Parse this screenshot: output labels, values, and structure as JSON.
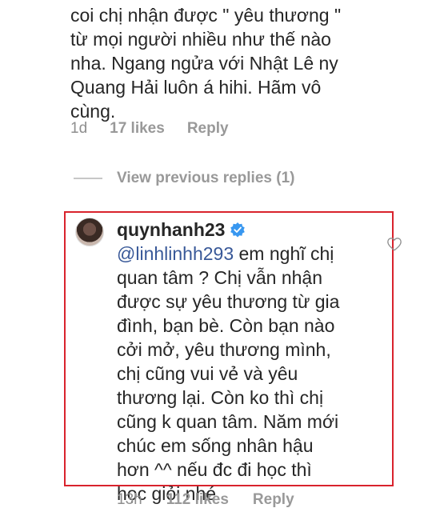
{
  "top_comment": {
    "text": "coi chị nhận được \" yêu thương \"\ntừ mọi người nhiều như thế nào\nnha. Ngang ngửa với Nhật Lê ny\nQuang Hải luôn á hihi. Hãm vô\ncùng.",
    "time": "1d",
    "likes": "17 likes",
    "reply_label": "Reply"
  },
  "view_previous": {
    "label": "View previous replies (1)"
  },
  "reply": {
    "username": "quynhanh23",
    "mention": "@linhlinhh293",
    "text": " em nghĩ chị\nquan tâm ? Chị vẫn nhận\nđược sự yêu thương từ gia\nđình, bạn bè. Còn bạn nào\ncởi mở, yêu thương mình,\nchị cũng vui vẻ và yêu\nthương lại. Còn ko thì chị\ncũng k quan tâm. Năm mới\nchúc em sống nhân hậu\nhơn ^^ nếu đc đi học thì\nhọc giỏi nhé",
    "time": "13h",
    "likes": "112 likes",
    "reply_label": "Reply",
    "verified_color": "#3897f0",
    "highlight_color": "#d9232d"
  },
  "icons": {
    "verified": "verified-badge-icon",
    "heart": "heart-outline-icon",
    "avatar": "user-avatar"
  }
}
